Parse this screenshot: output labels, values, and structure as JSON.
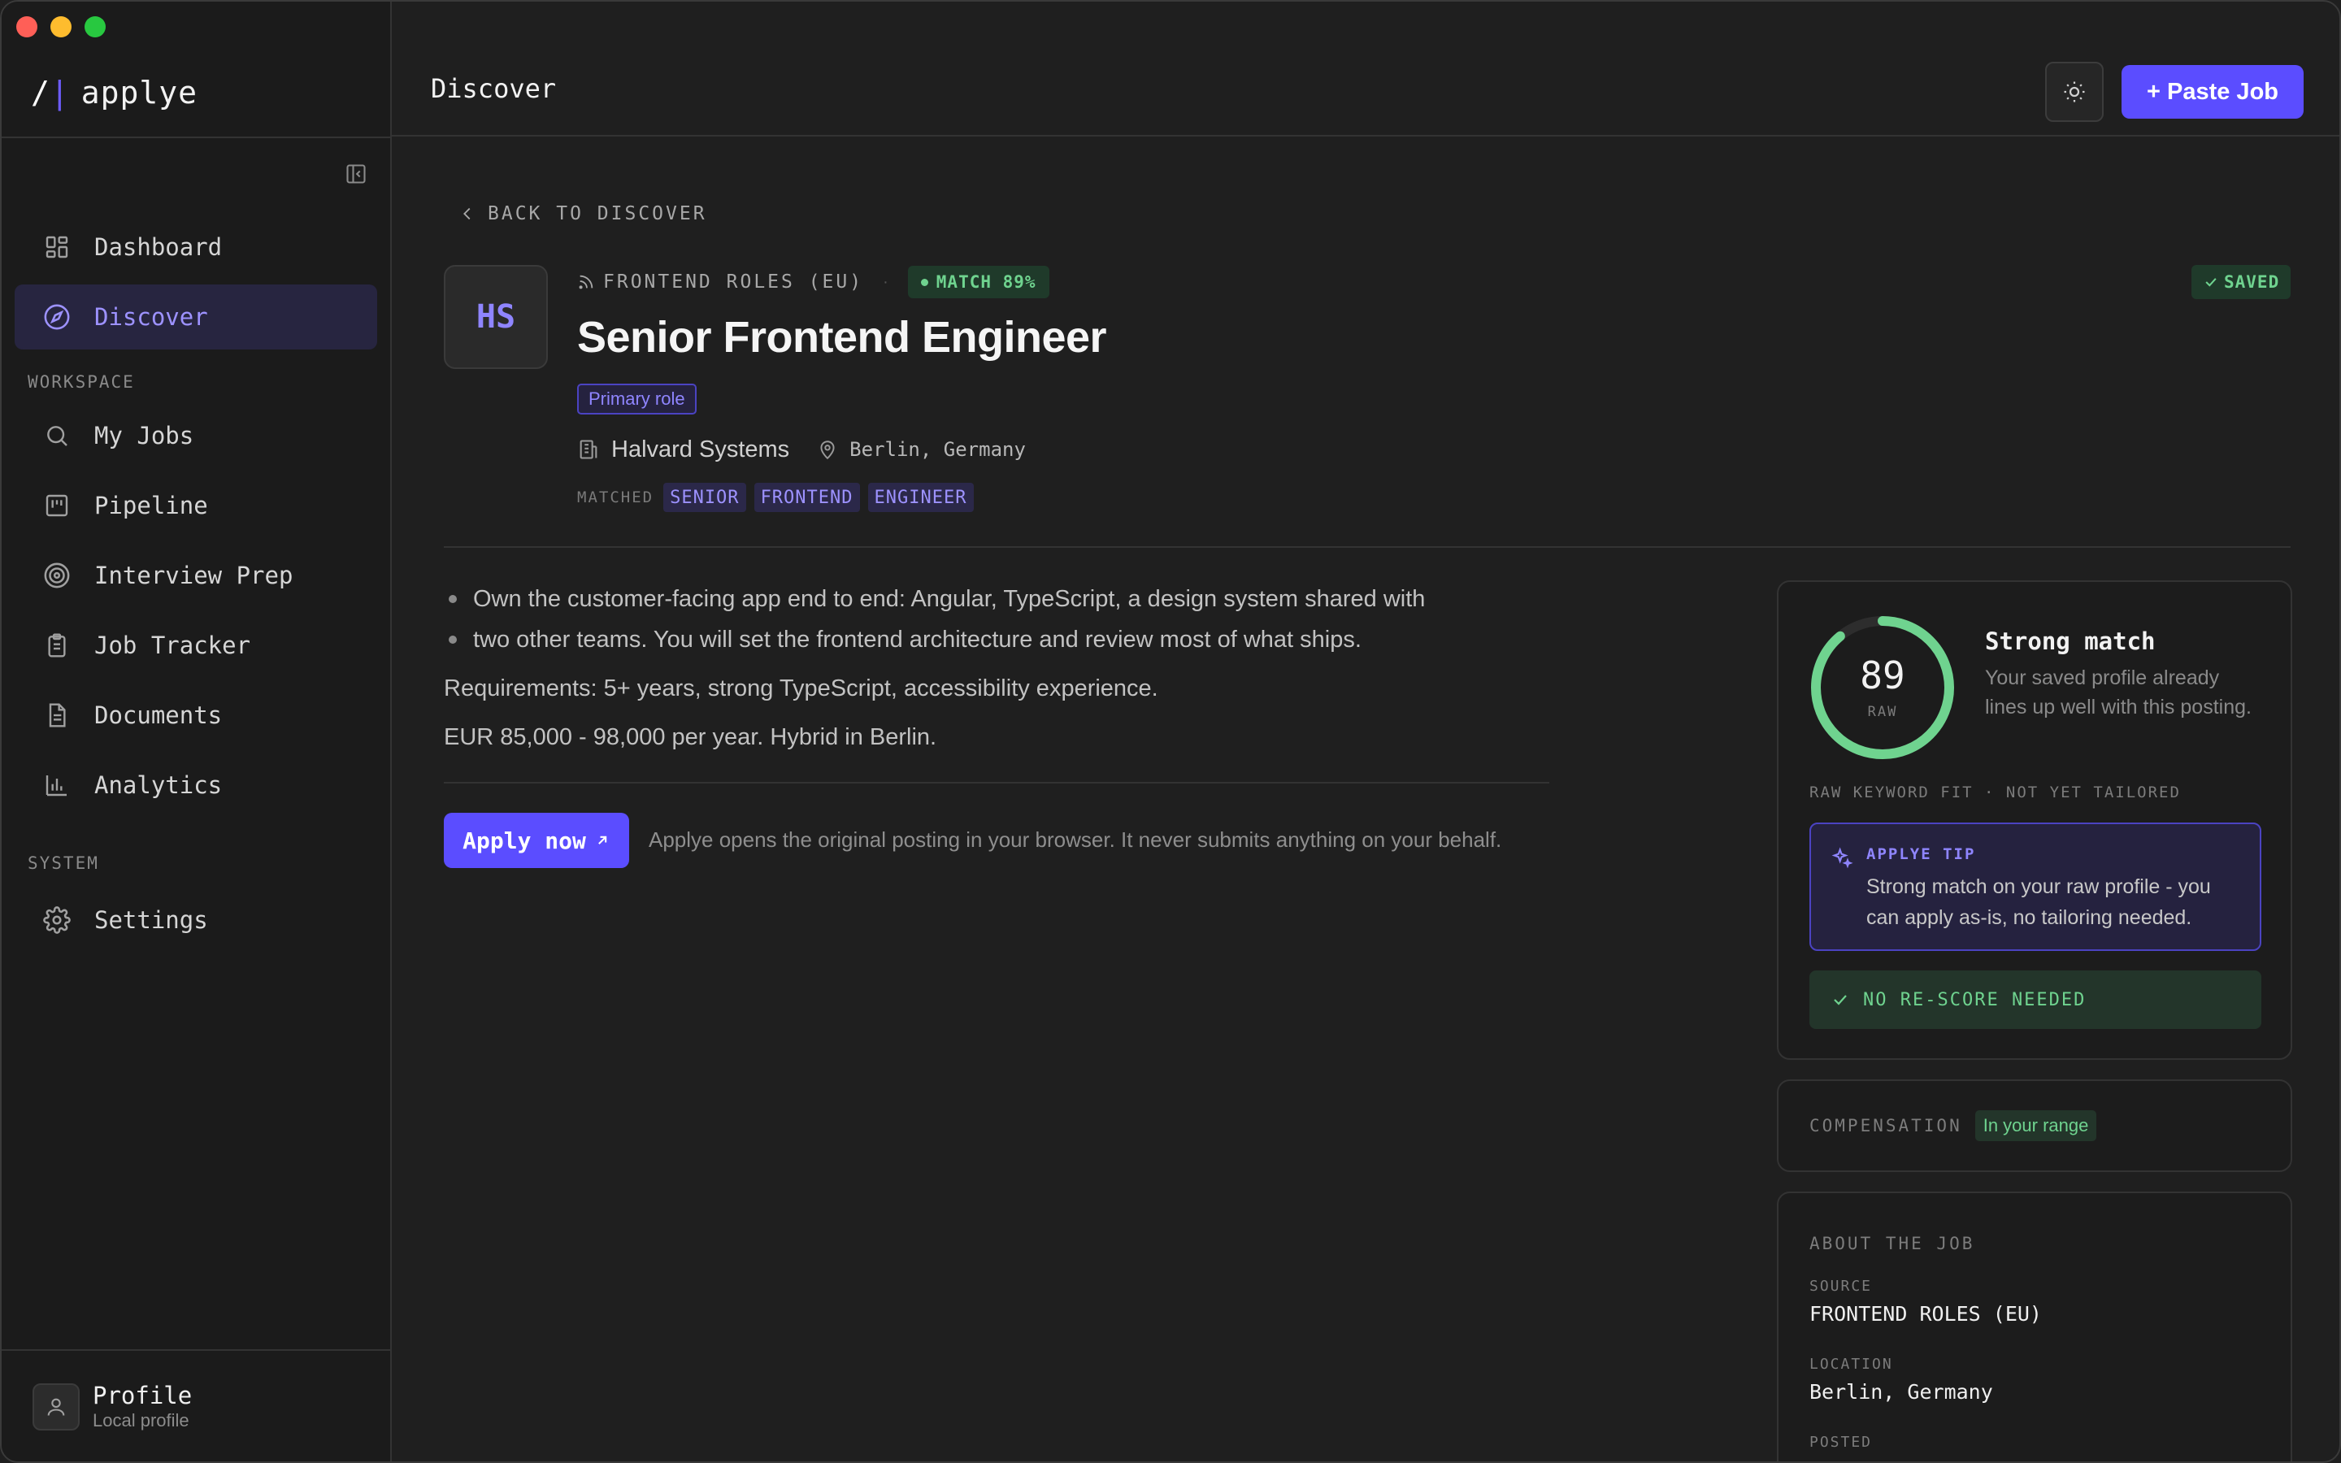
{
  "app": {
    "brand_mark_slash": "/",
    "brand_mark_bar": "|",
    "name": "applye",
    "accent_color": "#5b4dff",
    "success_color": "#6fd38f"
  },
  "header": {
    "page_title": "Discover",
    "theme_icon": "sun-icon",
    "paste_job_label": "+ Paste Job"
  },
  "sidebar": {
    "top_items": [
      {
        "label": "Dashboard",
        "icon": "dashboard-icon",
        "active": false
      },
      {
        "label": "Discover",
        "icon": "compass-icon",
        "active": true
      }
    ],
    "workspace_label": "WORKSPACE",
    "workspace_items": [
      {
        "label": "My Jobs",
        "icon": "search-icon"
      },
      {
        "label": "Pipeline",
        "icon": "kanban-icon"
      },
      {
        "label": "Interview Prep",
        "icon": "target-icon"
      },
      {
        "label": "Job Tracker",
        "icon": "clipboard-icon"
      },
      {
        "label": "Documents",
        "icon": "document-icon"
      },
      {
        "label": "Analytics",
        "icon": "bar-chart-icon"
      }
    ],
    "system_label": "SYSTEM",
    "system_items": [
      {
        "label": "Settings",
        "icon": "gear-icon"
      }
    ],
    "profile": {
      "name": "Profile",
      "subtitle": "Local profile"
    }
  },
  "job": {
    "back_label": "BACK TO DISCOVER",
    "logo_initials": "HS",
    "source": "FRONTEND ROLES (EU)",
    "separator": "·",
    "match_label": "MATCH 89%",
    "saved_label": "SAVED",
    "title": "Senior Frontend Engineer",
    "role_badge": "Primary role",
    "company": "Halvard Systems",
    "location": "Berlin, Germany",
    "matched_label": "MATCHED",
    "matched_keywords": [
      "SENIOR",
      "FRONTEND",
      "ENGINEER"
    ],
    "description_bullets": [
      "Own the customer-facing app end to end: Angular, TypeScript, a design system shared with",
      "two other teams. You will set the frontend architecture and review most of what ships."
    ],
    "requirements": "Requirements: 5+ years, strong TypeScript, accessibility experience.",
    "compensation_text": "EUR 85,000 - 98,000 per year. Hybrid in Berlin.",
    "apply_label": "Apply now",
    "apply_note": "Applye opens the original posting in your browser. It never submits anything on your behalf."
  },
  "match_card": {
    "score": "89",
    "score_value": 89,
    "score_max": 100,
    "score_caption": "RAW",
    "headline": "Strong match",
    "description": "Your saved profile already lines up well with this posting.",
    "fit_caption": "RAW KEYWORD FIT · NOT YET TAILORED",
    "tip_label": "APPLYE TIP",
    "tip_text": "Strong match on your raw profile - you can apply as-is, no tailoring needed.",
    "rescore_label": "NO RE-SCORE NEEDED"
  },
  "compensation_card": {
    "label": "COMPENSATION",
    "badge": "In your range"
  },
  "about_card": {
    "title": "ABOUT THE JOB",
    "fields": [
      {
        "key": "SOURCE",
        "value": "FRONTEND ROLES (EU)"
      },
      {
        "key": "LOCATION",
        "value": "Berlin, Germany"
      },
      {
        "key": "POSTED",
        "value": ""
      }
    ]
  }
}
